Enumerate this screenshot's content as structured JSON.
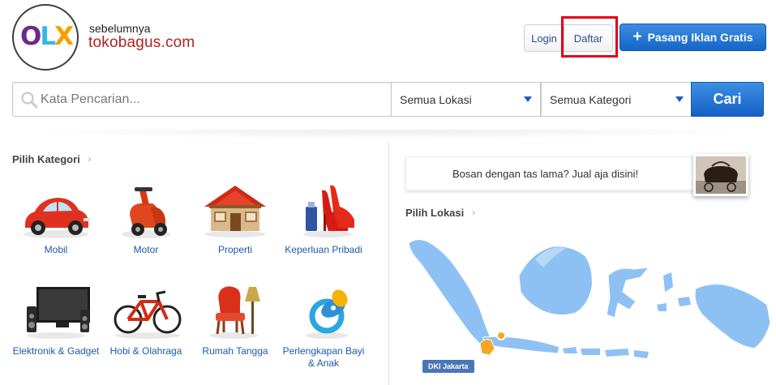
{
  "brand": {
    "logo_letters": [
      "O",
      "L",
      "X"
    ],
    "tagline_small": "sebelumnya",
    "tagline_big": "tokobagus.com"
  },
  "header": {
    "login_label": "Login",
    "register_label": "Daftar",
    "post_ad_label": "Pasang Iklan Gratis"
  },
  "search": {
    "placeholder": "Kata Pencarian...",
    "location_selected": "Semua Lokasi",
    "category_selected": "Semua Kategori",
    "button_label": "Cari"
  },
  "categories": {
    "title": "Pilih Kategori",
    "items": [
      {
        "label": "Mobil",
        "icon": "car-icon"
      },
      {
        "label": "Motor",
        "icon": "scooter-icon"
      },
      {
        "label": "Properti",
        "icon": "house-icon"
      },
      {
        "label": "Keperluan Pribadi",
        "icon": "shoes-perfume-icon"
      },
      {
        "label": "Elektronik & Gadget",
        "icon": "tv-speakers-icon"
      },
      {
        "label": "Hobi & Olahraga",
        "icon": "bicycle-icon"
      },
      {
        "label": "Rumah Tangga",
        "icon": "chair-lamp-icon"
      },
      {
        "label": "Perlengkapan Bayi & Anak",
        "icon": "pacifier-icon"
      }
    ]
  },
  "promo": {
    "text": "Bosan dengan tas lama? Jual aja disini!",
    "image": "handbag-photo"
  },
  "locations": {
    "title": "Pilih Lokasi",
    "highlighted_label": "DKI Jakarta",
    "map_color": "#8ec1f3",
    "highlight_color": "#f5a623"
  },
  "colors": {
    "primary_button": "#1d6fd4",
    "link": "#1d5aa8",
    "highlight_box": "#e0001a"
  }
}
